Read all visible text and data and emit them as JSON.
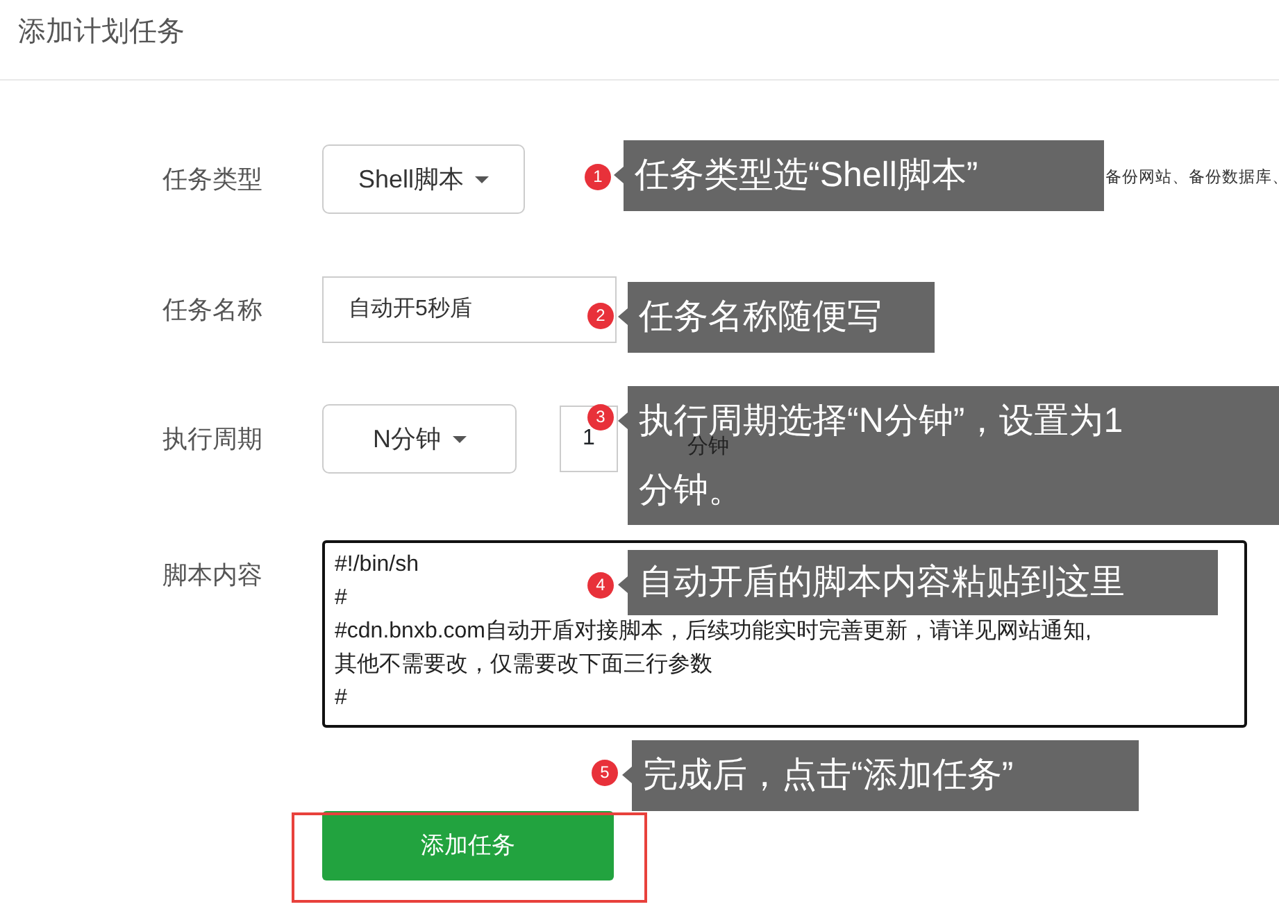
{
  "title": "添加计划任务",
  "form": [
    {
      "kind": "select",
      "label": "任务类型",
      "value": "Shell脚本",
      "hint": "备份网站、备份数据库、"
    },
    {
      "kind": "text",
      "label": "任务名称",
      "value": "自动开5秒盾"
    },
    {
      "kind": "period",
      "label": "执行周期",
      "value": "N分钟",
      "number": "1",
      "unit": "分钟"
    },
    {
      "kind": "script",
      "label": "脚本内容",
      "lines": [
        "#!/bin/sh",
        "#",
        "#cdn.bnxb.com自动开盾对接脚本，后续功能实时完善更新，请详见网站通知,",
        "其他不需要改，仅需要改下面三行参数",
        "#"
      ]
    }
  ],
  "submit": {
    "label": "添加任务",
    "highlighted": true
  },
  "annotations": [
    {
      "number": "1",
      "text": "任务类型选“Shell脚本”"
    },
    {
      "number": "2",
      "text": "任务名称随便写"
    },
    {
      "number": "3",
      "text": "执行周期选择“N分钟”，设置为1分钟。"
    },
    {
      "number": "4",
      "text": "自动开盾的脚本内容粘贴到这里"
    },
    {
      "number": "5",
      "text": "完成后，点击“添加任务”"
    }
  ]
}
